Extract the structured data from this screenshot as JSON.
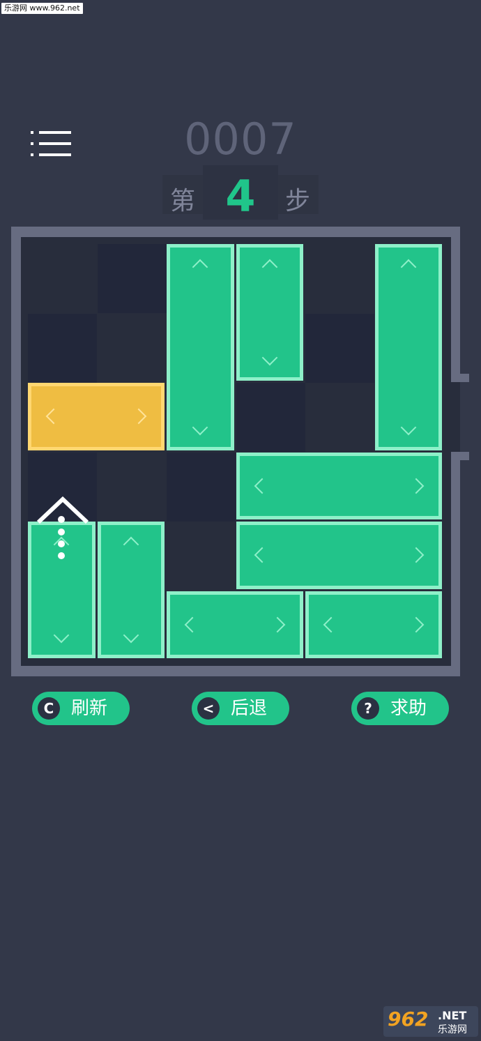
{
  "watermark": {
    "top_text": "乐游网 www.962.net"
  },
  "header": {
    "menu_icon": "menu-list-icon",
    "score": "0007",
    "steps_prefix": "第",
    "steps_value": "4",
    "steps_suffix": "步"
  },
  "board": {
    "grid_size": 6,
    "colors": {
      "frame": "#676c81",
      "block": "#22c48a",
      "block_border": "#8ef0c9",
      "target": "#efbd42",
      "light_cell": "#282d3c",
      "dark_cell": "#22273a"
    },
    "blocks": [
      {
        "id": "target",
        "kind": "target",
        "orientation": "horizontal",
        "row": 2,
        "col": 0,
        "length": 2
      },
      {
        "id": "v1",
        "kind": "normal",
        "orientation": "vertical",
        "row": 0,
        "col": 2,
        "length": 3
      },
      {
        "id": "v2",
        "kind": "normal",
        "orientation": "vertical",
        "row": 0,
        "col": 3,
        "length": 2
      },
      {
        "id": "v3",
        "kind": "normal",
        "orientation": "vertical",
        "row": 0,
        "col": 5,
        "length": 3
      },
      {
        "id": "h1",
        "kind": "normal",
        "orientation": "horizontal",
        "row": 3,
        "col": 3,
        "length": 3
      },
      {
        "id": "h2",
        "kind": "normal",
        "orientation": "horizontal",
        "row": 4,
        "col": 3,
        "length": 3
      },
      {
        "id": "v4",
        "kind": "normal",
        "orientation": "vertical",
        "row": 4,
        "col": 0,
        "length": 2
      },
      {
        "id": "v5",
        "kind": "normal",
        "orientation": "vertical",
        "row": 4,
        "col": 1,
        "length": 2
      },
      {
        "id": "h3",
        "kind": "normal",
        "orientation": "horizontal",
        "row": 5,
        "col": 2,
        "length": 2
      },
      {
        "id": "h4",
        "kind": "normal",
        "orientation": "horizontal",
        "row": 5,
        "col": 4,
        "length": 2
      }
    ],
    "dark_cells": [
      [
        0,
        1
      ],
      [
        1,
        0
      ],
      [
        1,
        4
      ],
      [
        2,
        3
      ],
      [
        3,
        0
      ],
      [
        3,
        2
      ]
    ]
  },
  "controls": {
    "refresh": {
      "label": "刷新",
      "icon": "refresh-icon",
      "glyph": "C"
    },
    "undo": {
      "label": "后退",
      "icon": "back-chevron-icon",
      "glyph": "<"
    },
    "help": {
      "label": "求助",
      "icon": "question-icon",
      "glyph": "?"
    }
  },
  "footer_logo": {
    "number": "962",
    "net": ".NET",
    "cn": "乐游网"
  }
}
